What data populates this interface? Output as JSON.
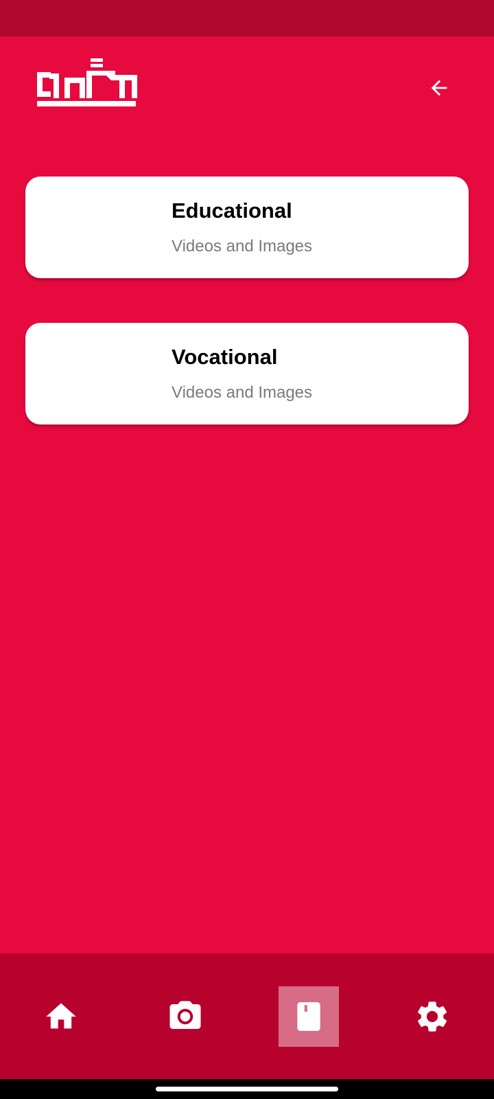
{
  "header": {
    "logo_text": "သင်ယူ",
    "back_icon": "arrow-left-icon"
  },
  "cards": [
    {
      "title": "Educational",
      "subtitle": "Videos and Images"
    },
    {
      "title": "Vocational",
      "subtitle": "Videos and Images"
    }
  ],
  "bottom_nav": {
    "items": [
      {
        "icon": "home-icon",
        "active": false
      },
      {
        "icon": "camera-icon",
        "active": false
      },
      {
        "icon": "book-icon",
        "active": true
      },
      {
        "icon": "settings-icon",
        "active": false
      }
    ]
  },
  "colors": {
    "background": "#e60a3f",
    "status_bar": "#b00830",
    "bottom_nav": "#b8022e",
    "card": "#ffffff",
    "subtitle": "#7a7a7a"
  }
}
